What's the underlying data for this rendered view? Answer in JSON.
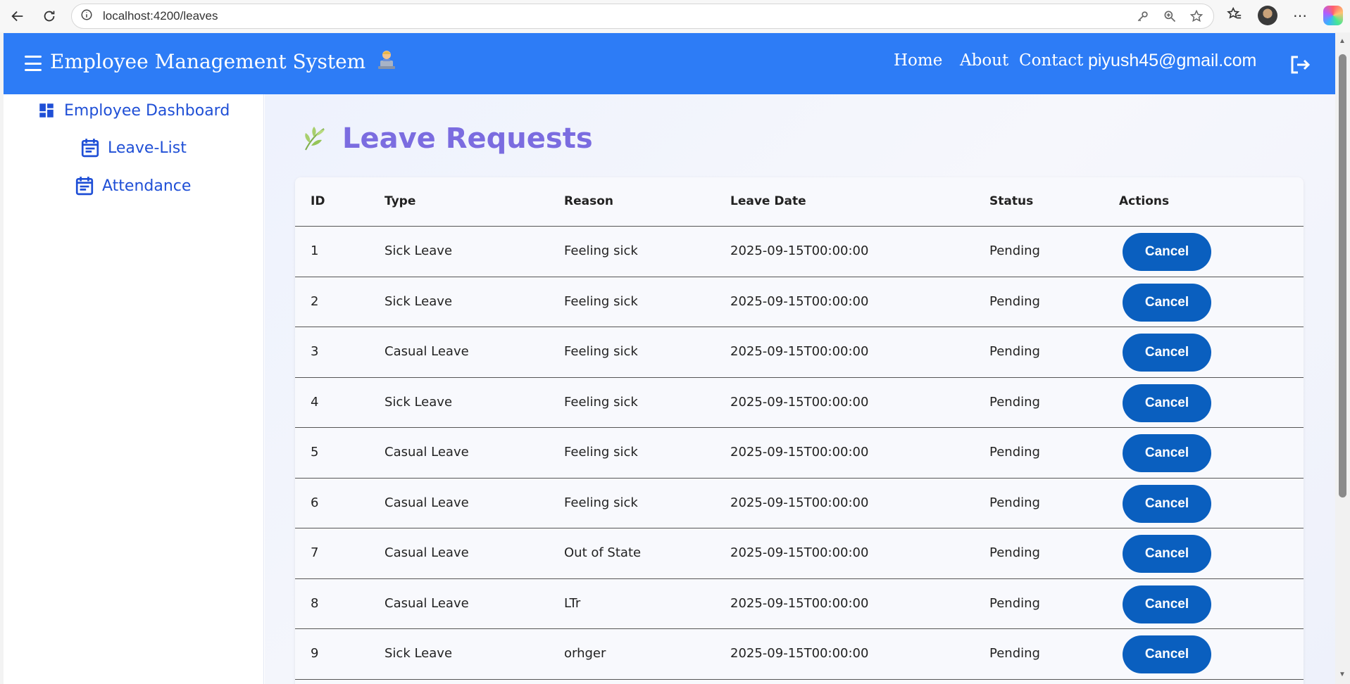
{
  "browser": {
    "url": "localhost:4200/leaves",
    "icons": [
      "back-icon",
      "refresh-icon",
      "info-icon",
      "key-icon",
      "zoom-icon",
      "star-icon",
      "favorites-icon",
      "profile-avatar",
      "more-icon",
      "copilot-icon"
    ]
  },
  "header": {
    "title": "Employee Management System",
    "nav": {
      "home": "Home",
      "about": "About",
      "contact": "Contact"
    },
    "email": "piyush45@gmail.com"
  },
  "sidebar": {
    "items": [
      {
        "label": "Employee Dashboard",
        "icon": "dashboard-icon"
      },
      {
        "label": "Leave-List",
        "icon": "calendar-icon"
      },
      {
        "label": "Attendance",
        "icon": "calendar-icon"
      }
    ]
  },
  "main": {
    "title": "Leave Requests",
    "table": {
      "headers": {
        "id": "ID",
        "type": "Type",
        "reason": "Reason",
        "date": "Leave Date",
        "status": "Status",
        "actions": "Actions"
      },
      "rows": [
        {
          "id": "1",
          "type": "Sick Leave",
          "reason": "Feeling sick",
          "date": "2025-09-15T00:00:00",
          "status": "Pending",
          "action": "Cancel"
        },
        {
          "id": "2",
          "type": "Sick Leave",
          "reason": "Feeling sick",
          "date": "2025-09-15T00:00:00",
          "status": "Pending",
          "action": "Cancel"
        },
        {
          "id": "3",
          "type": "Casual Leave",
          "reason": "Feeling sick",
          "date": "2025-09-15T00:00:00",
          "status": "Pending",
          "action": "Cancel"
        },
        {
          "id": "4",
          "type": "Sick Leave",
          "reason": "Feeling sick",
          "date": "2025-09-15T00:00:00",
          "status": "Pending",
          "action": "Cancel"
        },
        {
          "id": "5",
          "type": "Casual Leave",
          "reason": "Feeling sick",
          "date": "2025-09-15T00:00:00",
          "status": "Pending",
          "action": "Cancel"
        },
        {
          "id": "6",
          "type": "Casual Leave",
          "reason": "Feeling sick",
          "date": "2025-09-15T00:00:00",
          "status": "Pending",
          "action": "Cancel"
        },
        {
          "id": "7",
          "type": "Casual Leave",
          "reason": "Out of State",
          "date": "2025-09-15T00:00:00",
          "status": "Pending",
          "action": "Cancel"
        },
        {
          "id": "8",
          "type": "Casual Leave",
          "reason": "LTr",
          "date": "2025-09-15T00:00:00",
          "status": "Pending",
          "action": "Cancel"
        },
        {
          "id": "9",
          "type": "Sick Leave",
          "reason": "orhger",
          "date": "2025-09-15T00:00:00",
          "status": "Pending",
          "action": "Cancel"
        }
      ]
    }
  },
  "colors": {
    "header": "#2d7cf6",
    "accent": "#1f4fd6",
    "title": "#7b6ce0",
    "button": "#0a5fbf"
  }
}
